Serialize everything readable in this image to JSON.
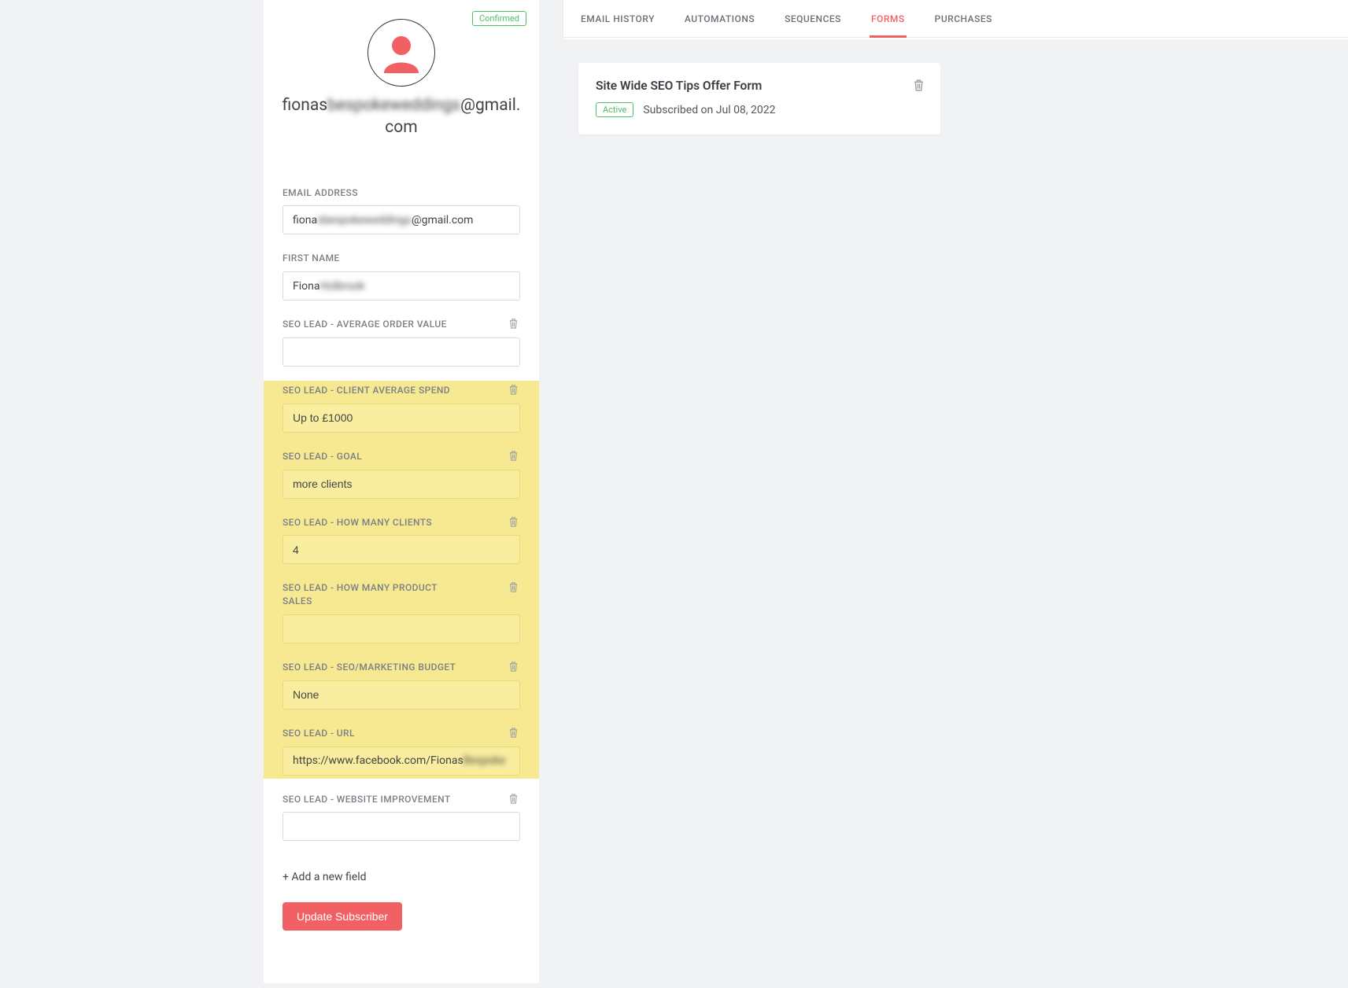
{
  "profile": {
    "confirmed_label": "Confirmed",
    "email_display_prefix": "fionas",
    "email_display_blur": "bespokeweddings",
    "email_display_suffix": "@gmail.com"
  },
  "fields": {
    "email_label": "EMAIL ADDRESS",
    "email_value_prefix": "fiona",
    "email_value_blur": "sbespokeweddings",
    "email_value_suffix": "@gmail.com",
    "first_name_label": "FIRST NAME",
    "first_name_value_prefix": "Fiona ",
    "first_name_value_blur": "Holbrook",
    "aov_label": "SEO LEAD - AVERAGE ORDER VALUE",
    "aov_value": "",
    "cas_label": "SEO LEAD - CLIENT AVERAGE SPEND",
    "cas_value": "Up to £1000",
    "goal_label": "SEO LEAD - GOAL",
    "goal_value": "more clients",
    "clients_label": "SEO LEAD - HOW MANY CLIENTS",
    "clients_value": "4",
    "product_sales_label": "SEO LEAD - HOW MANY PRODUCT SALES",
    "product_sales_value": "",
    "budget_label": "SEO LEAD - SEO/MARKETING BUDGET",
    "budget_value": "None",
    "url_label": "SEO LEAD - URL",
    "url_value_prefix": "https://www.facebook.com/Fionas",
    "url_value_blur": "Bespoke",
    "improvement_label": "SEO LEAD - WEBSITE IMPROVEMENT",
    "improvement_value": ""
  },
  "actions": {
    "add_field": "+ Add a new field",
    "update": "Update Subscriber"
  },
  "tabs": {
    "email_history": "EMAIL HISTORY",
    "automations": "AUTOMATIONS",
    "sequences": "SEQUENCES",
    "forms": "FORMS",
    "purchases": "PURCHASES"
  },
  "form_card": {
    "title": "Site Wide SEO Tips Offer Form",
    "status": "Active",
    "subscribed": "Subscribed on Jul 08, 2022"
  }
}
